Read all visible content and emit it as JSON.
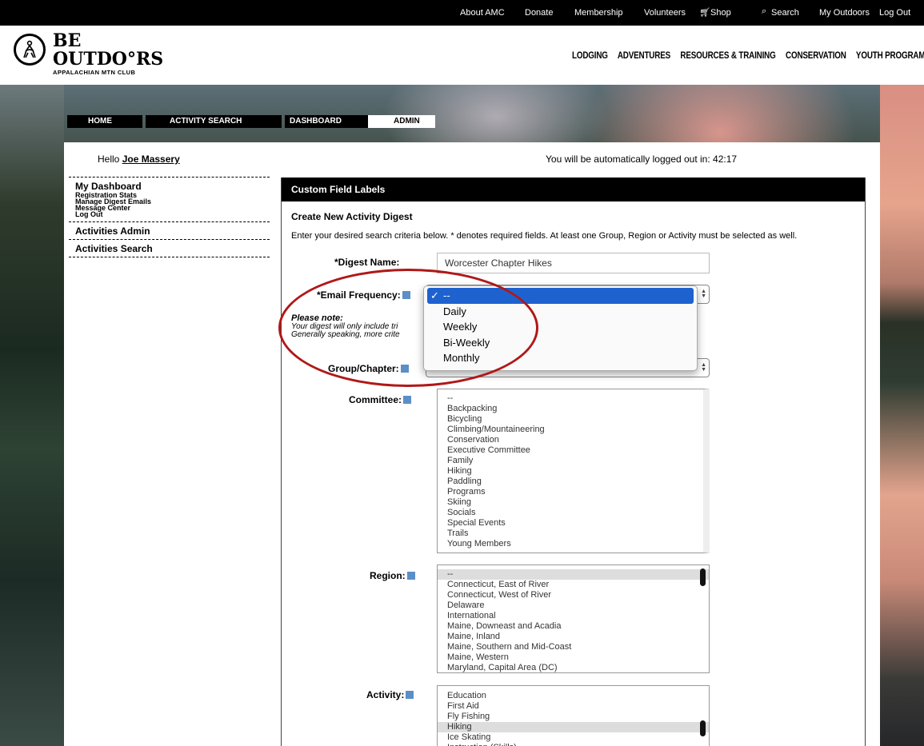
{
  "topbar": {
    "links": [
      "About AMC",
      "Donate",
      "Membership",
      "Volunteers",
      "Shop",
      "Search",
      "My Outdoors",
      "Log Out"
    ]
  },
  "logo": {
    "line1": "BE",
    "line2": "OUTDO°RS",
    "subtitle": "APPALACHIAN MTN CLUB"
  },
  "main_nav": [
    "LODGING",
    "ADVENTURES",
    "RESOURCES & TRAINING",
    "CONSERVATION",
    "YOUTH PROGRAMS"
  ],
  "breadcrumbs": [
    "HOME",
    "ACTIVITY SEARCH",
    "DASHBOARD",
    "ADMIN"
  ],
  "greeting": {
    "prefix": "Hello",
    "name": "Joe Massery",
    "timer_text": "You will be automatically logged out in: 42:17"
  },
  "sidebar": {
    "dashboard": {
      "title": "My Dashboard",
      "items": [
        "Registration Stats",
        "Manage Digest Emails",
        "Message Center",
        "Log Out"
      ]
    },
    "activities_admin": "Activities Admin",
    "activities_search": "Activities Search"
  },
  "form": {
    "header": "Custom Field Labels",
    "subtitle": "Create New Activity Digest",
    "intro": "Enter your desired search criteria below. * denotes required fields. At least one Group, Region or Activity must be selected as well.",
    "digest_name_label": "*Digest Name:",
    "digest_name_value": "Worcester Chapter Hikes",
    "email_freq_label": "*Email Frequency:",
    "note_title": "Please note:",
    "note_line1": "Your digest will only include tri",
    "note_line2": "Generally speaking, more crite",
    "group_label": "Group/Chapter:",
    "committee_label": "Committee:",
    "region_label": "Region:",
    "activity_label": "Activity:"
  },
  "freq_options": [
    "--",
    "Daily",
    "Weekly",
    "Bi-Weekly",
    "Monthly"
  ],
  "committee_options": [
    "--",
    "Backpacking",
    "Bicycling",
    "Climbing/Mountaineering",
    "Conservation",
    "Executive Committee",
    "Family",
    "Hiking",
    "Paddling",
    "Programs",
    "Skiing",
    "Socials",
    "Special Events",
    "Trails",
    "Young Members"
  ],
  "region_options": [
    "--",
    "Connecticut, East of River",
    "Connecticut, West of River",
    "Delaware",
    "International",
    "Maine, Downeast and Acadia",
    "Maine, Inland",
    "Maine, Southern and Mid-Coast",
    "Maine, Western",
    "Maryland, Capital Area (DC)"
  ],
  "activity_options": [
    "Education",
    "First Aid",
    "Fly Fishing",
    "Hiking",
    "Ice Skating",
    "Instruction (Skills)"
  ]
}
